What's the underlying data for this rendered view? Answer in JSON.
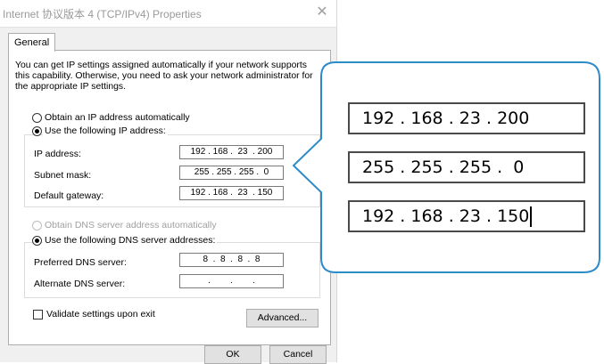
{
  "window": {
    "title": "Internet 协议版本 4 (TCP/IPv4) Properties",
    "close_glyph": "✕"
  },
  "tabs": [
    {
      "label": "General",
      "active": true
    }
  ],
  "intro_text": "You can get IP settings assigned automatically if your network supports this capability. Otherwise, you need to ask your network administrator for the appropriate IP settings.",
  "ip_section": {
    "auto_label": "Obtain an IP address automatically",
    "auto_selected": false,
    "manual_label": "Use the following IP address:",
    "manual_selected": true,
    "fields": [
      {
        "label": "IP address:",
        "value": "192 . 168 .  23  . 200"
      },
      {
        "label": "Subnet mask:",
        "value": "255 . 255 . 255 .  0"
      },
      {
        "label": "Default gateway:",
        "value": "192 . 168 .  23  . 150"
      }
    ]
  },
  "dns_section": {
    "auto_label": "Obtain DNS server address automatically",
    "auto_selected": false,
    "auto_enabled": false,
    "manual_label": "Use the following DNS server addresses:",
    "manual_selected": true,
    "fields": [
      {
        "label": "Preferred DNS server:",
        "value": "8  .  8  .  8  .  8"
      },
      {
        "label": "Alternate DNS server:",
        "value": ".        .        ."
      }
    ]
  },
  "validate": {
    "label": "Validate settings upon exit",
    "checked": false
  },
  "buttons": {
    "advanced": "Advanced...",
    "ok": "OK",
    "cancel": "Cancel"
  },
  "zoom_callout": {
    "values": [
      "192 . 168 . 23 . 200",
      "255 . 255 . 255 .  0",
      "192 . 168 . 23 . 150"
    ],
    "border_color": "#2e8bc9"
  }
}
